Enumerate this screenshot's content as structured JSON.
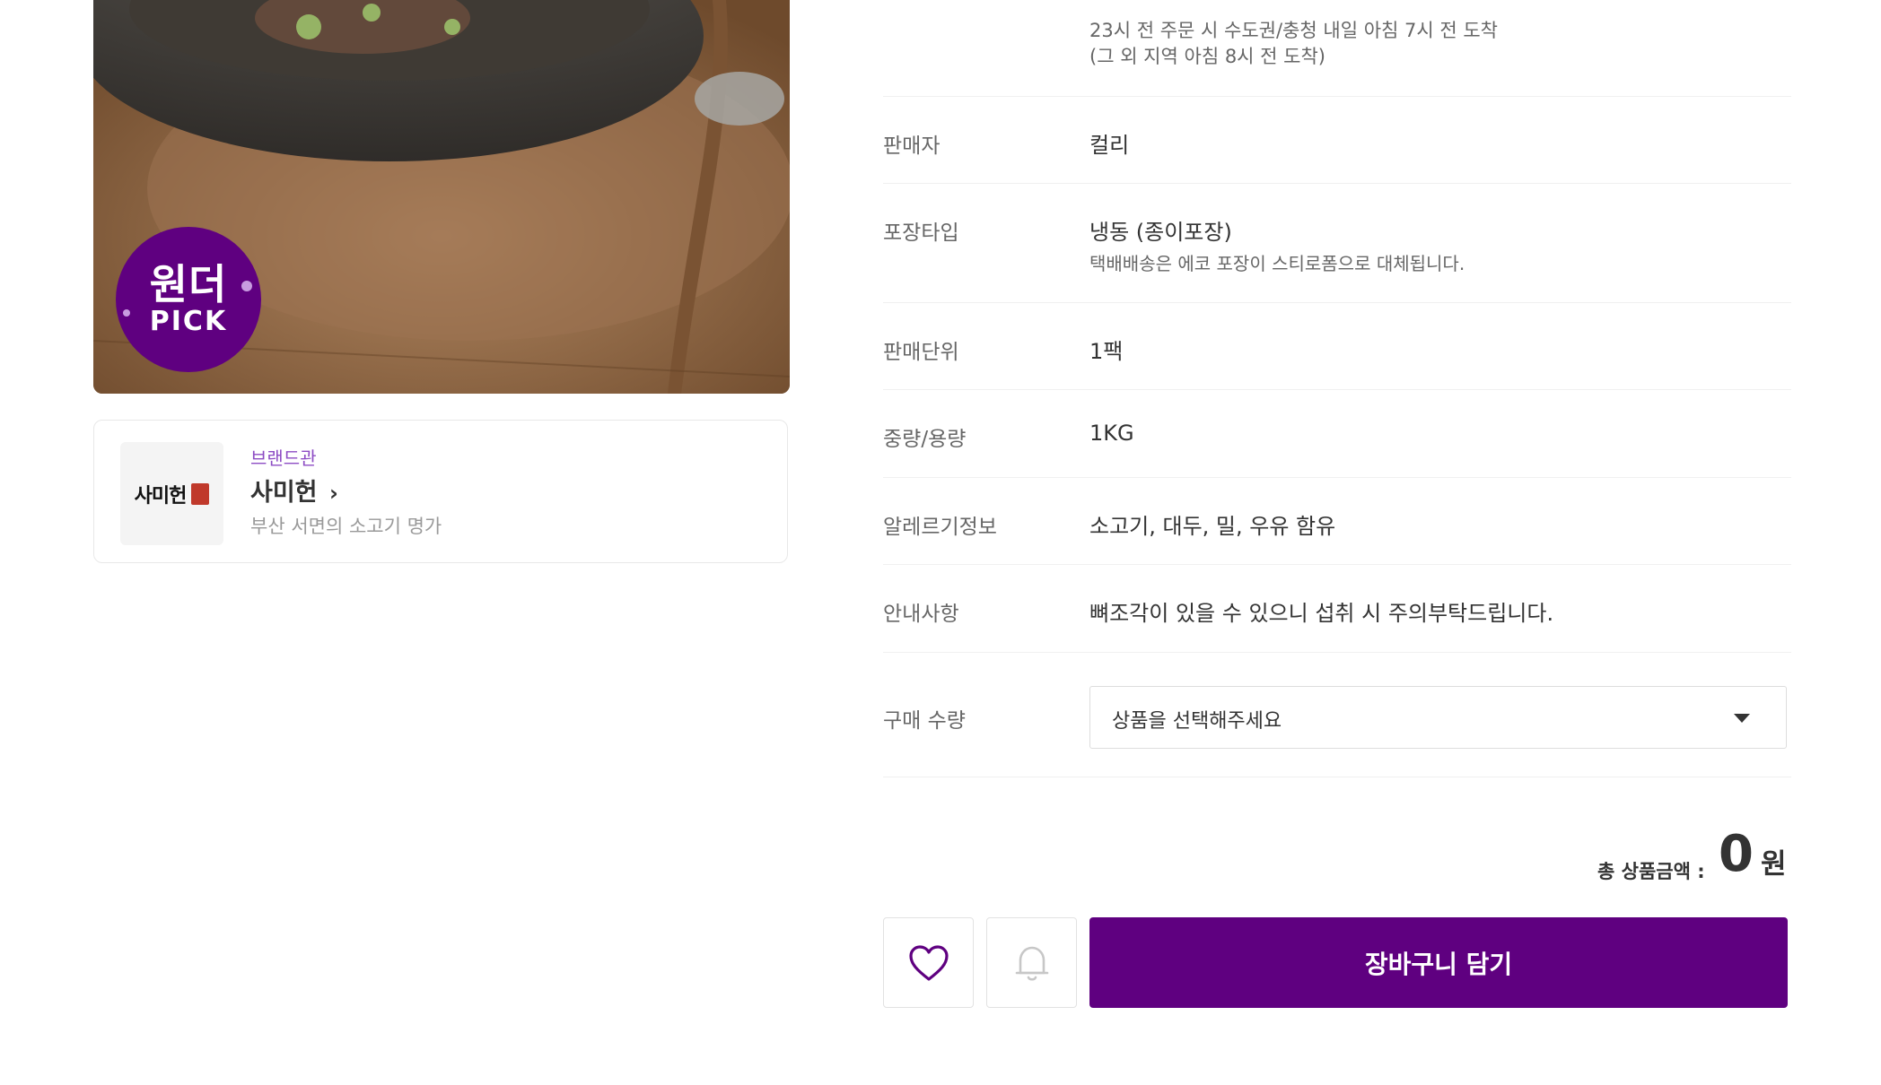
{
  "product_image": {
    "alt": "",
    "badge_line1": "원더",
    "badge_line2": "PICK"
  },
  "brand": {
    "eyebrow": "브랜드관",
    "name": "사미헌",
    "description": "부산 서면의 소고기 명가",
    "logo_text": "사미헌"
  },
  "delivery": {
    "line1": "23시 전 주문 시 수도권/충청 내일 아침 7시 전 도착",
    "line2": "(그 외 지역 아침 8시 전 도착)"
  },
  "info_rows": [
    {
      "label": "판매자",
      "value": "컬리"
    },
    {
      "label": "포장타입",
      "value": "냉동 (종이포장)",
      "sub": "택배배송은 에코 포장이 스티로폼으로 대체됩니다."
    },
    {
      "label": "판매단위",
      "value": "1팩"
    },
    {
      "label": "중량/용량",
      "value": "1KG"
    },
    {
      "label": "알레르기정보",
      "value": "소고기, 대두, 밀, 우유 함유"
    },
    {
      "label": "안내사항",
      "value": "뼈조각이 있을 수 있으니 섭취 시 주의부탁드립니다."
    }
  ],
  "quantity": {
    "label": "구매 수량",
    "placeholder": "상품을 선택해주세요"
  },
  "total": {
    "label": "총 상품금액 :",
    "amount": "0",
    "unit": "원"
  },
  "actions": {
    "wishlist_icon": "heart-icon",
    "notify_icon": "bell-icon",
    "cart_label": "장바구니 담기"
  },
  "colors": {
    "accent": "#5f0080",
    "brand_eyebrow": "#8d4cc4",
    "divider": "#f0f0f0"
  }
}
